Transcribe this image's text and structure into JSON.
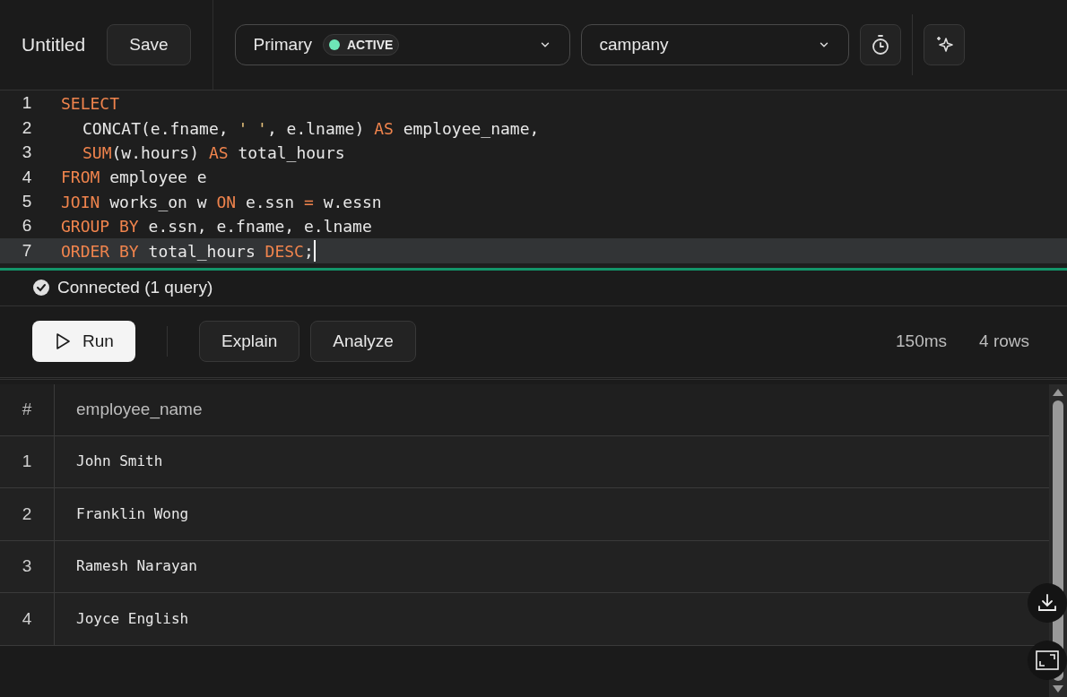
{
  "toolbar": {
    "title": "Untitled",
    "save": "Save",
    "connection": {
      "name": "Primary",
      "status": "ACTIVE",
      "color": "#6ee7b7"
    },
    "database": "campany"
  },
  "editor": {
    "lines": [
      {
        "number": "1",
        "active": false,
        "indented": false,
        "tokens": [
          {
            "kind": "keyword",
            "text": "SELECT"
          }
        ]
      },
      {
        "number": "2",
        "active": false,
        "indented": true,
        "tokens": [
          {
            "kind": "plain",
            "text": "CONCAT(e.fname, "
          },
          {
            "kind": "string",
            "text": "' '"
          },
          {
            "kind": "plain",
            "text": ", e.lname) "
          },
          {
            "kind": "keyword",
            "text": "AS"
          },
          {
            "kind": "plain",
            "text": " employee_name,"
          }
        ]
      },
      {
        "number": "3",
        "active": false,
        "indented": true,
        "tokens": [
          {
            "kind": "keyword",
            "text": "SUM"
          },
          {
            "kind": "plain",
            "text": "(w.hours) "
          },
          {
            "kind": "keyword",
            "text": "AS"
          },
          {
            "kind": "plain",
            "text": " total_hours"
          }
        ]
      },
      {
        "number": "4",
        "active": false,
        "indented": false,
        "tokens": [
          {
            "kind": "keyword",
            "text": "FROM"
          },
          {
            "kind": "plain",
            "text": " employee e"
          }
        ]
      },
      {
        "number": "5",
        "active": false,
        "indented": false,
        "tokens": [
          {
            "kind": "keyword",
            "text": "JOIN"
          },
          {
            "kind": "plain",
            "text": " works_on w "
          },
          {
            "kind": "keyword",
            "text": "ON"
          },
          {
            "kind": "plain",
            "text": " e.ssn "
          },
          {
            "kind": "keyword",
            "text": "="
          },
          {
            "kind": "plain",
            "text": " w.essn"
          }
        ]
      },
      {
        "number": "6",
        "active": false,
        "indented": false,
        "tokens": [
          {
            "kind": "keyword",
            "text": "GROUP BY"
          },
          {
            "kind": "plain",
            "text": " e.ssn, e.fname, e.lname"
          }
        ]
      },
      {
        "number": "7",
        "active": true,
        "indented": false,
        "tokens": [
          {
            "kind": "keyword",
            "text": "ORDER BY"
          },
          {
            "kind": "plain",
            "text": " total_hours "
          },
          {
            "kind": "keyword",
            "text": "DESC"
          },
          {
            "kind": "plain",
            "text": ";"
          }
        ]
      }
    ]
  },
  "status": {
    "text": "Connected (1 query)"
  },
  "actions": {
    "run": "Run",
    "explain": "Explain",
    "analyze": "Analyze",
    "duration": "150ms",
    "row_count": "4 rows"
  },
  "table": {
    "columns": [
      "#",
      "employee_name"
    ],
    "rows": [
      {
        "index": "1",
        "employee_name": "John Smith"
      },
      {
        "index": "2",
        "employee_name": "Franklin Wong"
      },
      {
        "index": "3",
        "employee_name": "Ramesh Narayan"
      },
      {
        "index": "4",
        "employee_name": "Joyce English"
      }
    ]
  }
}
